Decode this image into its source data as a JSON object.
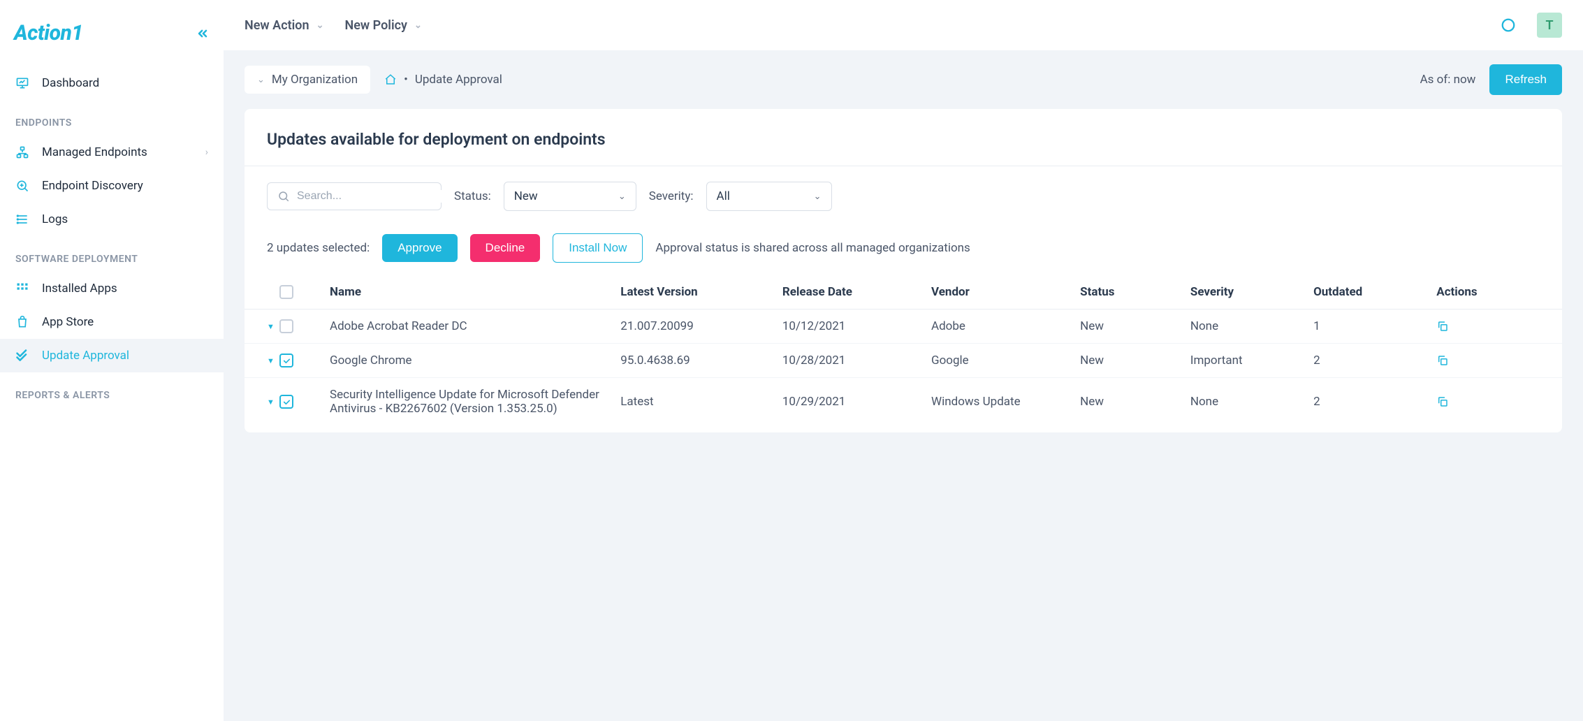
{
  "brand": "Action1",
  "topbar": {
    "new_action": "New Action",
    "new_policy": "New Policy",
    "avatar_letter": "T"
  },
  "sidebar": {
    "dashboard": "Dashboard",
    "section_endpoints": "ENDPOINTS",
    "managed_endpoints": "Managed Endpoints",
    "endpoint_discovery": "Endpoint Discovery",
    "logs": "Logs",
    "section_software": "SOFTWARE DEPLOYMENT",
    "installed_apps": "Installed Apps",
    "app_store": "App Store",
    "update_approval": "Update Approval",
    "section_reports": "REPORTS & ALERTS"
  },
  "breadcrumb": {
    "org": "My Organization",
    "page": "Update Approval",
    "as_of": "As of: now",
    "refresh": "Refresh"
  },
  "panel": {
    "title": "Updates available for deployment on endpoints",
    "search_placeholder": "Search...",
    "status_label": "Status:",
    "status_value": "New",
    "severity_label": "Severity:",
    "severity_value": "All",
    "selected_text": "2 updates selected:",
    "approve": "Approve",
    "decline": "Decline",
    "install_now": "Install Now",
    "info": "Approval status is shared across all managed organizations"
  },
  "columns": {
    "name": "Name",
    "latest_version": "Latest Version",
    "release_date": "Release Date",
    "vendor": "Vendor",
    "status": "Status",
    "severity": "Severity",
    "outdated": "Outdated",
    "actions": "Actions"
  },
  "rows": [
    {
      "checked": false,
      "name": "Adobe Acrobat Reader DC",
      "version": "21.007.20099",
      "date": "10/12/2021",
      "vendor": "Adobe",
      "status": "New",
      "severity": "None",
      "outdated": "1"
    },
    {
      "checked": true,
      "name": "Google Chrome",
      "version": "95.0.4638.69",
      "date": "10/28/2021",
      "vendor": "Google",
      "status": "New",
      "severity": "Important",
      "outdated": "2"
    },
    {
      "checked": true,
      "name": "Security Intelligence Update for Microsoft Defender Antivirus - KB2267602 (Version 1.353.25.0)",
      "version": "Latest",
      "date": "10/29/2021",
      "vendor": "Windows Update",
      "status": "New",
      "severity": "None",
      "outdated": "2"
    }
  ]
}
